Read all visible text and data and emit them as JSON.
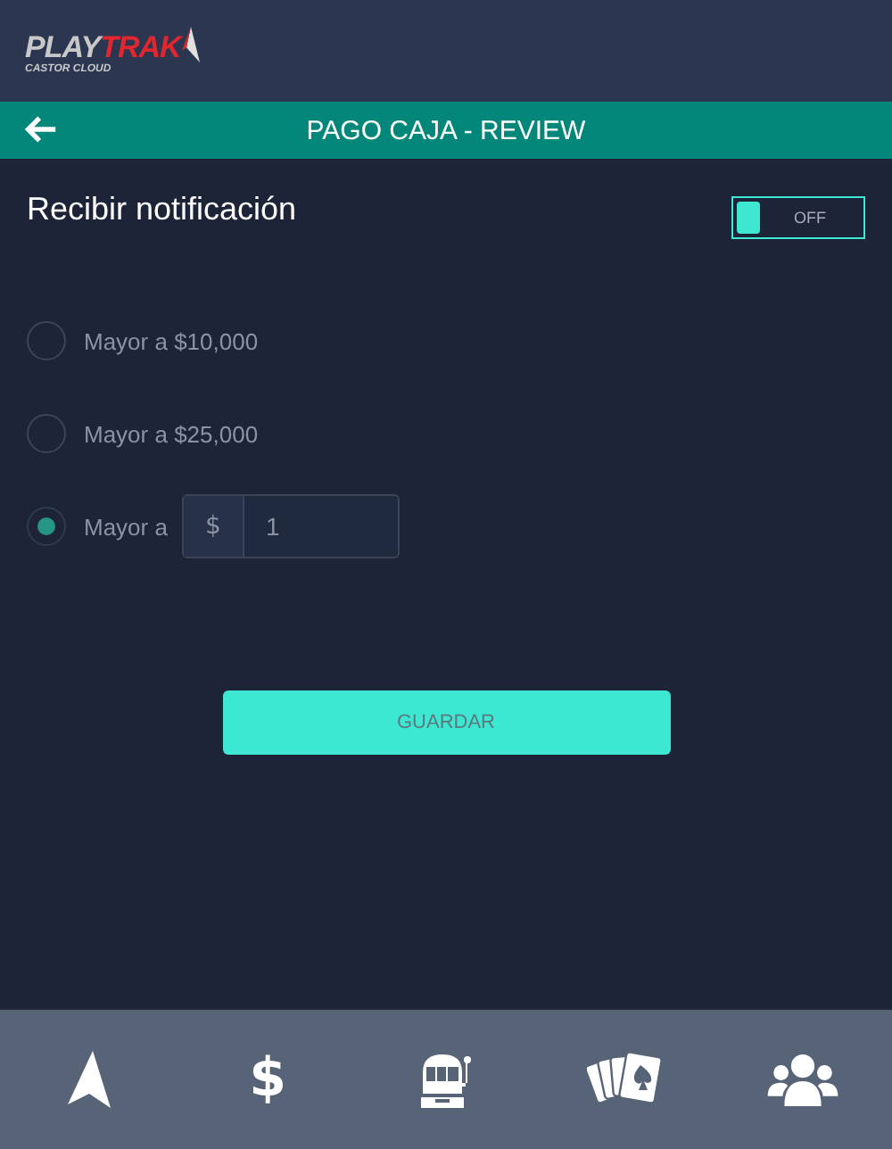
{
  "logo": {
    "part_1": "PLAY",
    "part_2": "TRAK",
    "tagline": "CASTOR CLOUD"
  },
  "title_bar": {
    "title": "PAGO CAJA - REVIEW"
  },
  "notification": {
    "label": "Recibir notificación",
    "toggle": {
      "on": false,
      "text": "OFF"
    }
  },
  "options": [
    {
      "kind": "radio",
      "label": "Mayor a $10,000",
      "selected": false
    },
    {
      "kind": "radio",
      "label": "Mayor a $25,000",
      "selected": false
    },
    {
      "kind": "custom",
      "label": "Mayor a",
      "prefix": "$",
      "value": "1",
      "selected": true
    }
  ],
  "save_button": "GUARDAR",
  "nav": [
    {
      "kind": "arrow"
    },
    {
      "kind": "dollar",
      "glyph": "$"
    },
    {
      "kind": "slot"
    },
    {
      "kind": "cards"
    },
    {
      "kind": "users"
    }
  ]
}
